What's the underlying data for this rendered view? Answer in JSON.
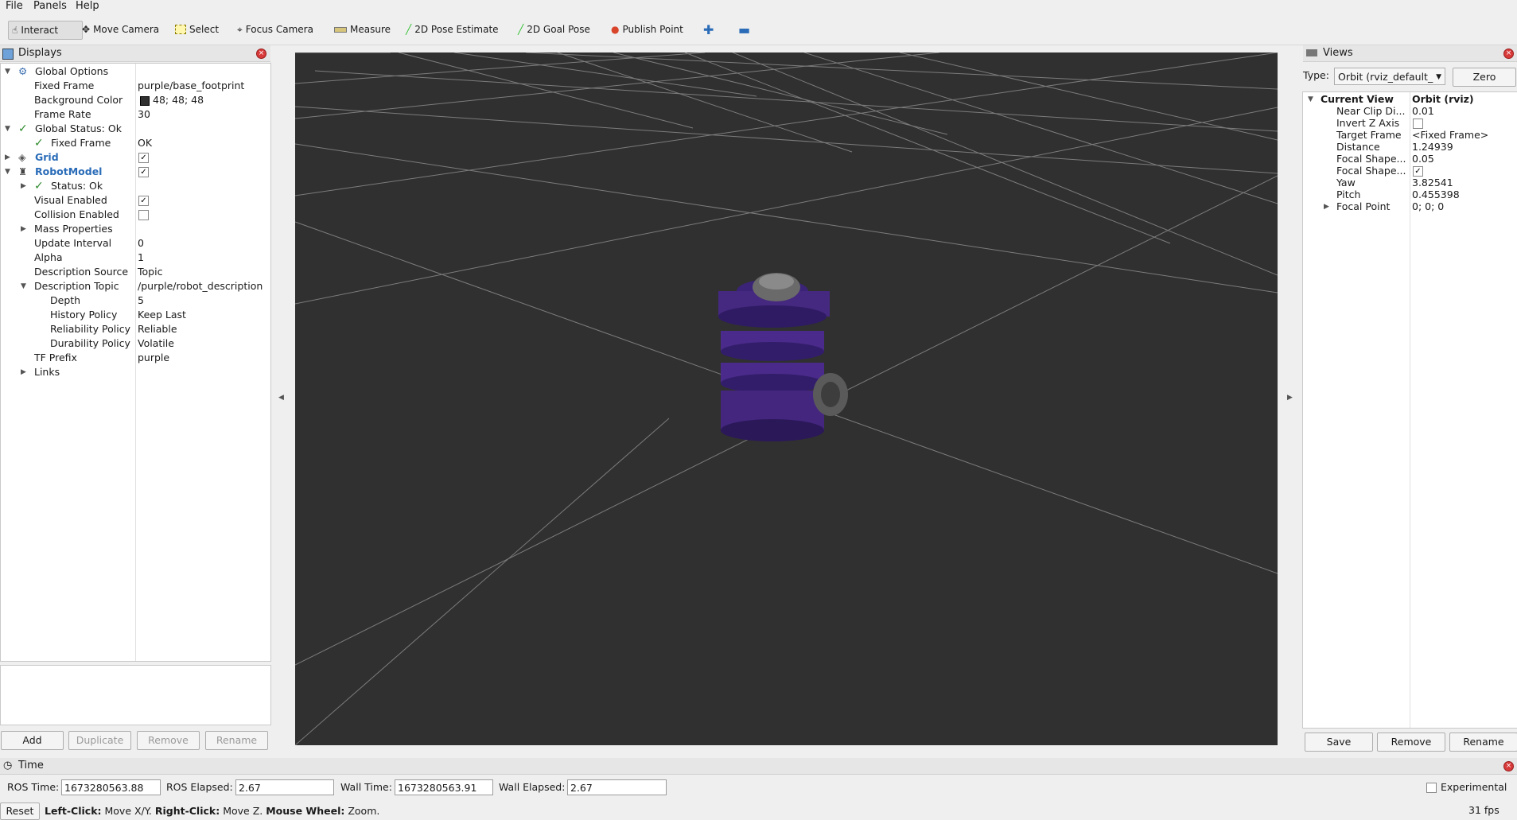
{
  "menu": {
    "file": "File",
    "panels": "Panels",
    "help": "Help"
  },
  "toolbar": {
    "interact": "Interact",
    "move_camera": "Move Camera",
    "select": "Select",
    "focus_camera": "Focus Camera",
    "measure": "Measure",
    "pose_estimate": "2D Pose Estimate",
    "goal_pose": "2D Goal Pose",
    "publish_point": "Publish Point"
  },
  "displays": {
    "title": "Displays",
    "rows": [
      {
        "label": "Global Options",
        "value": ""
      },
      {
        "label": "Fixed Frame",
        "value": "purple/base_footprint"
      },
      {
        "label": "Background Color",
        "value": "48; 48; 48"
      },
      {
        "label": "Frame Rate",
        "value": "30"
      },
      {
        "label": "Global Status: Ok",
        "value": ""
      },
      {
        "label": "Fixed Frame",
        "value": "OK"
      },
      {
        "label": "Grid",
        "value": ""
      },
      {
        "label": "RobotModel",
        "value": ""
      },
      {
        "label": "Status: Ok",
        "value": ""
      },
      {
        "label": "Visual Enabled",
        "value": ""
      },
      {
        "label": "Collision Enabled",
        "value": ""
      },
      {
        "label": "Mass Properties",
        "value": ""
      },
      {
        "label": "Update Interval",
        "value": "0"
      },
      {
        "label": "Alpha",
        "value": "1"
      },
      {
        "label": "Description Source",
        "value": "Topic"
      },
      {
        "label": "Description Topic",
        "value": "/purple/robot_description"
      },
      {
        "label": "Depth",
        "value": "5"
      },
      {
        "label": "History Policy",
        "value": "Keep Last"
      },
      {
        "label": "Reliability Policy",
        "value": "Reliable"
      },
      {
        "label": "Durability Policy",
        "value": "Volatile"
      },
      {
        "label": "TF Prefix",
        "value": "purple"
      },
      {
        "label": "Links",
        "value": ""
      }
    ],
    "buttons": {
      "add": "Add",
      "duplicate": "Duplicate",
      "remove": "Remove",
      "rename": "Rename"
    }
  },
  "views": {
    "title": "Views",
    "type_label": "Type:",
    "type_value": "Orbit (rviz_default_",
    "zero": "Zero",
    "rows": [
      {
        "label": "Current View",
        "value": "Orbit (rviz)"
      },
      {
        "label": "Near Clip Di...",
        "value": "0.01"
      },
      {
        "label": "Invert Z Axis",
        "value": ""
      },
      {
        "label": "Target Frame",
        "value": "<Fixed Frame>"
      },
      {
        "label": "Distance",
        "value": "1.24939"
      },
      {
        "label": "Focal Shape...",
        "value": "0.05"
      },
      {
        "label": "Focal Shape...",
        "value": ""
      },
      {
        "label": "Yaw",
        "value": "3.82541"
      },
      {
        "label": "Pitch",
        "value": "0.455398"
      },
      {
        "label": "Focal Point",
        "value": "0; 0; 0"
      }
    ],
    "buttons": {
      "save": "Save",
      "remove": "Remove",
      "rename": "Rename"
    }
  },
  "time": {
    "title": "Time",
    "ros_time_label": "ROS Time:",
    "ros_time": "1673280563.88",
    "ros_elapsed_label": "ROS Elapsed:",
    "ros_elapsed": "2.67",
    "wall_time_label": "Wall Time:",
    "wall_time": "1673280563.91",
    "wall_elapsed_label": "Wall Elapsed:",
    "wall_elapsed": "2.67",
    "experimental": "Experimental"
  },
  "status": {
    "reset": "Reset",
    "left_click": "Left-Click:",
    "left_click_desc": "Move X/Y.",
    "right_click": "Right-Click:",
    "right_click_desc": "Move Z.",
    "wheel": "Mouse Wheel:",
    "wheel_desc": "Zoom.",
    "fps": "31 fps"
  },
  "colors": {
    "viewport_bg": "#303030",
    "robot_purple": "#4a2a8a",
    "accent_blue": "#2a6cb8"
  }
}
